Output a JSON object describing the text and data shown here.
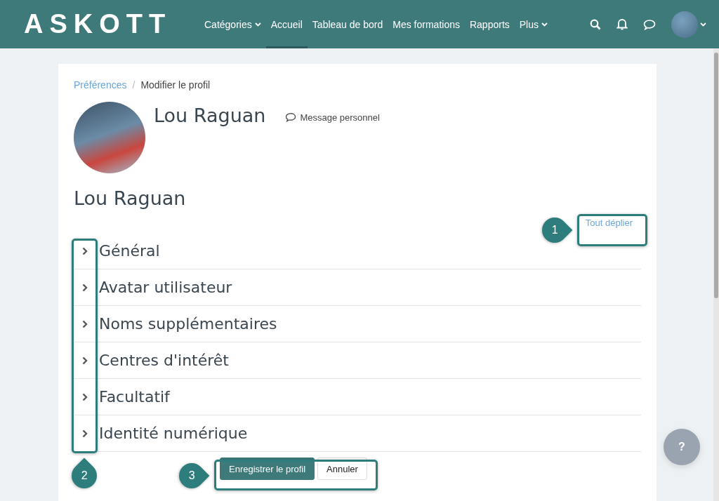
{
  "navbar": {
    "logo": "ASKOTT",
    "items": [
      {
        "label": "Catégories",
        "has_menu": true,
        "selected": false
      },
      {
        "label": "Accueil",
        "has_menu": false,
        "selected": true
      },
      {
        "label": "Tableau de bord",
        "has_menu": false,
        "selected": false
      },
      {
        "label": "Mes formations",
        "has_menu": false,
        "selected": false
      },
      {
        "label": "Rapports",
        "has_menu": false,
        "selected": false
      },
      {
        "label": "Plus",
        "has_menu": true,
        "selected": false
      }
    ]
  },
  "breadcrumb": [
    {
      "label": "Préférences",
      "link": true
    },
    {
      "label": "Modifier le profil",
      "link": false
    }
  ],
  "breadcrumb_separator": "/",
  "profile": {
    "name": "Lou Raguan",
    "message_link": "Message personnel"
  },
  "page_heading": "Lou Raguan",
  "expand_all": "Tout déplier",
  "sections": [
    {
      "title": "Général",
      "expanded": false
    },
    {
      "title": "Avatar utilisateur",
      "expanded": false
    },
    {
      "title": "Noms supplémentaires",
      "expanded": false
    },
    {
      "title": "Centres d'intérêt",
      "expanded": false
    },
    {
      "title": "Facultatif",
      "expanded": false
    },
    {
      "title": "Identité numérique",
      "expanded": false
    }
  ],
  "buttons": [
    {
      "label": "Enregistrer le profil",
      "kind": "primary"
    },
    {
      "label": "Annuler",
      "kind": "secondary"
    }
  ],
  "help_button": "?",
  "annotations": [
    {
      "label": "1"
    },
    {
      "label": "2"
    },
    {
      "label": "3"
    }
  ]
}
